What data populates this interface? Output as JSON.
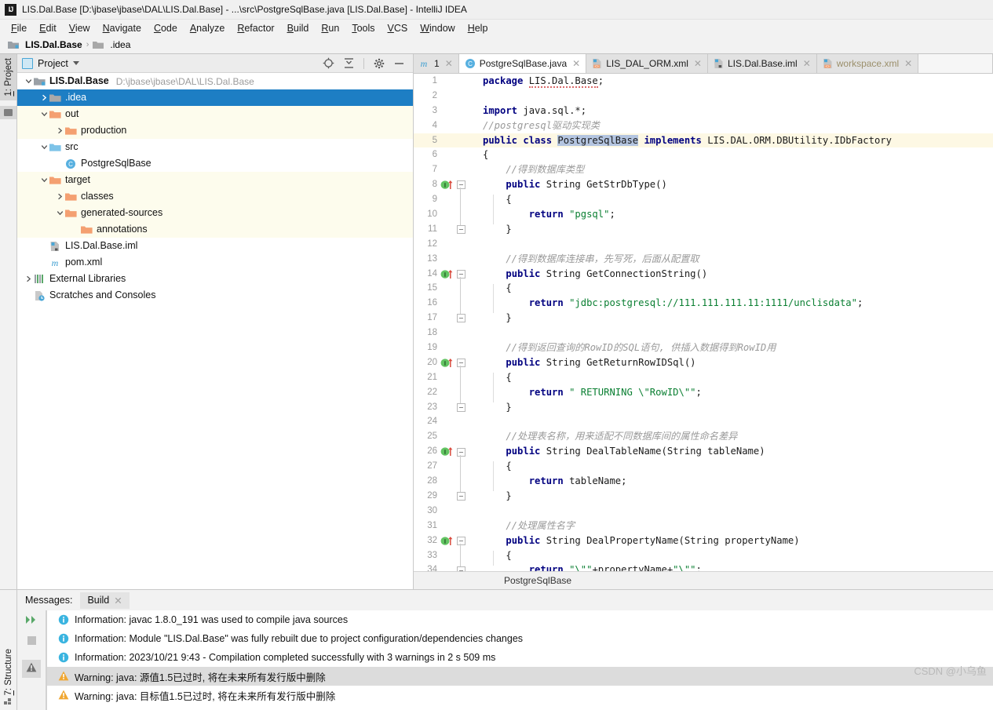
{
  "window": {
    "title": "LIS.Dal.Base [D:\\jbase\\jbase\\DAL\\LIS.Dal.Base] - ...\\src\\PostgreSqlBase.java [LIS.Dal.Base] - IntelliJ IDEA",
    "logo": "IJ"
  },
  "menubar": {
    "items": [
      {
        "label": "File"
      },
      {
        "label": "Edit"
      },
      {
        "label": "View"
      },
      {
        "label": "Navigate"
      },
      {
        "label": "Code"
      },
      {
        "label": "Analyze"
      },
      {
        "label": "Refactor"
      },
      {
        "label": "Build"
      },
      {
        "label": "Run"
      },
      {
        "label": "Tools"
      },
      {
        "label": "VCS"
      },
      {
        "label": "Window"
      },
      {
        "label": "Help"
      }
    ]
  },
  "breadcrumb": {
    "items": [
      {
        "label": "LIS.Dal.Base",
        "icon": "module-icon"
      },
      {
        "label": ".idea",
        "icon": "folder-icon"
      }
    ],
    "separator": "›"
  },
  "left_rail": {
    "project_button": "1: Project",
    "project_button_mnemonic": "1"
  },
  "project_panel": {
    "title": "Project",
    "toolbar": [
      {
        "name": "locate-target-icon"
      },
      {
        "name": "collapse-all-icon"
      },
      {
        "name": "gear-icon"
      },
      {
        "name": "minimize-icon"
      }
    ],
    "tree": [
      {
        "label": "LIS.Dal.Base",
        "path": "D:\\jbase\\jbase\\DAL\\LIS.Dal.Base",
        "depth": 0,
        "arrow": "down",
        "icon": "module-icon",
        "bold": true,
        "state": "normal"
      },
      {
        "label": ".idea",
        "depth": 1,
        "arrow": "right",
        "icon": "folder-gray-icon",
        "state": "selected"
      },
      {
        "label": "out",
        "depth": 1,
        "arrow": "down",
        "icon": "folder-orange-icon",
        "state": "excluded"
      },
      {
        "label": "production",
        "depth": 2,
        "arrow": "right",
        "icon": "folder-orange-icon",
        "state": "excluded"
      },
      {
        "label": "src",
        "depth": 1,
        "arrow": "down",
        "icon": "folder-blue-icon",
        "state": "normal"
      },
      {
        "label": "PostgreSqlBase",
        "depth": 2,
        "arrow": "none",
        "icon": "java-class-icon",
        "state": "normal"
      },
      {
        "label": "target",
        "depth": 1,
        "arrow": "down",
        "icon": "folder-orange-icon",
        "state": "excluded"
      },
      {
        "label": "classes",
        "depth": 2,
        "arrow": "right",
        "icon": "folder-orange-icon",
        "state": "excluded"
      },
      {
        "label": "generated-sources",
        "depth": 2,
        "arrow": "down",
        "icon": "folder-orange-icon",
        "state": "excluded"
      },
      {
        "label": "annotations",
        "depth": 3,
        "arrow": "none",
        "icon": "folder-orange-icon",
        "state": "excluded"
      },
      {
        "label": "LIS.Dal.Base.iml",
        "depth": 1,
        "arrow": "none",
        "icon": "iml-file-icon",
        "state": "normal"
      },
      {
        "label": "pom.xml",
        "depth": 1,
        "arrow": "none",
        "icon": "maven-icon",
        "state": "normal"
      },
      {
        "label": "External Libraries",
        "depth": 0,
        "arrow": "right",
        "icon": "libraries-icon",
        "state": "normal"
      },
      {
        "label": "Scratches and Consoles",
        "depth": 0,
        "arrow": "none",
        "icon": "scratches-icon",
        "state": "normal"
      }
    ]
  },
  "editor": {
    "tabs": [
      {
        "label": "1",
        "icon": "maven-icon",
        "active": false,
        "dim": false,
        "closable": true
      },
      {
        "label": "PostgreSqlBase.java",
        "icon": "java-class-icon",
        "active": true,
        "dim": false,
        "closable": true
      },
      {
        "label": "LIS_DAL_ORM.xml",
        "icon": "xml-file-icon",
        "active": false,
        "dim": false,
        "closable": true
      },
      {
        "label": "LIS.Dal.Base.iml",
        "icon": "iml-file-icon",
        "active": false,
        "dim": false,
        "closable": true
      },
      {
        "label": "workspace.xml",
        "icon": "xml-file-icon",
        "active": false,
        "dim": true,
        "closable": true
      }
    ],
    "status_text": "PostgreSqlBase",
    "highlighted_line": 5,
    "selected_token": "PostgreSqlBase",
    "lines": [
      {
        "n": 1,
        "tokens": [
          {
            "t": "package ",
            "c": "kw"
          },
          {
            "t": "LIS.Dal.Base",
            "c": "plain wavy"
          },
          {
            "t": ";",
            "c": "plain"
          }
        ]
      },
      {
        "n": 2,
        "tokens": []
      },
      {
        "n": 3,
        "tokens": [
          {
            "t": "import ",
            "c": "kw"
          },
          {
            "t": "java.sql.*;",
            "c": "plain"
          }
        ]
      },
      {
        "n": 4,
        "tokens": [
          {
            "t": "//postgresql驱动实现类",
            "c": "cm"
          }
        ]
      },
      {
        "n": 5,
        "tokens": [
          {
            "t": "public class ",
            "c": "kw"
          },
          {
            "t": "PostgreSqlBase",
            "c": "plain sel-tok"
          },
          {
            "t": " ",
            "c": "plain"
          },
          {
            "t": "implements ",
            "c": "kw"
          },
          {
            "t": "LIS.DAL.ORM.DBUtility.IDbFactory",
            "c": "plain"
          }
        ]
      },
      {
        "n": 6,
        "tokens": [
          {
            "t": "{",
            "c": "plain"
          }
        ]
      },
      {
        "n": 7,
        "tokens": [
          {
            "t": "    //得到数据库类型",
            "c": "cm"
          }
        ]
      },
      {
        "n": 8,
        "tokens": [
          {
            "t": "    ",
            "c": "plain"
          },
          {
            "t": "public ",
            "c": "kw"
          },
          {
            "t": "String GetStrDbType()",
            "c": "plain"
          }
        ],
        "gutter": "implements-mark"
      },
      {
        "n": 9,
        "tokens": [
          {
            "t": "    {",
            "c": "plain"
          }
        ]
      },
      {
        "n": 10,
        "tokens": [
          {
            "t": "        ",
            "c": "plain"
          },
          {
            "t": "return ",
            "c": "kw"
          },
          {
            "t": "\"pgsql\"",
            "c": "str"
          },
          {
            "t": ";",
            "c": "plain"
          }
        ]
      },
      {
        "n": 11,
        "tokens": [
          {
            "t": "    }",
            "c": "plain"
          }
        ]
      },
      {
        "n": 12,
        "tokens": []
      },
      {
        "n": 13,
        "tokens": [
          {
            "t": "    //得到数据库连接串，先写死，后面从配置取",
            "c": "cm"
          }
        ]
      },
      {
        "n": 14,
        "tokens": [
          {
            "t": "    ",
            "c": "plain"
          },
          {
            "t": "public ",
            "c": "kw"
          },
          {
            "t": "String GetConnectionString()",
            "c": "plain"
          }
        ],
        "gutter": "implements-mark"
      },
      {
        "n": 15,
        "tokens": [
          {
            "t": "    {",
            "c": "plain"
          }
        ]
      },
      {
        "n": 16,
        "tokens": [
          {
            "t": "        ",
            "c": "plain"
          },
          {
            "t": "return ",
            "c": "kw"
          },
          {
            "t": "\"jdbc:postgresql://111.111.111.11:1111/unclisdata\"",
            "c": "str"
          },
          {
            "t": ";",
            "c": "plain"
          }
        ],
        "redacted": true
      },
      {
        "n": 17,
        "tokens": [
          {
            "t": "    }",
            "c": "plain"
          }
        ]
      },
      {
        "n": 18,
        "tokens": []
      },
      {
        "n": 19,
        "tokens": [
          {
            "t": "    //得到返回查询的RowID的SQL语句, 供插入数据得到RowID用",
            "c": "cm"
          }
        ]
      },
      {
        "n": 20,
        "tokens": [
          {
            "t": "    ",
            "c": "plain"
          },
          {
            "t": "public ",
            "c": "kw"
          },
          {
            "t": "String GetReturnRowIDSql()",
            "c": "plain"
          }
        ],
        "gutter": "implements-mark"
      },
      {
        "n": 21,
        "tokens": [
          {
            "t": "    {",
            "c": "plain"
          }
        ]
      },
      {
        "n": 22,
        "tokens": [
          {
            "t": "        ",
            "c": "plain"
          },
          {
            "t": "return ",
            "c": "kw"
          },
          {
            "t": "\" RETURNING \\\"RowID\\\"\"",
            "c": "str"
          },
          {
            "t": ";",
            "c": "plain"
          }
        ]
      },
      {
        "n": 23,
        "tokens": [
          {
            "t": "    }",
            "c": "plain"
          }
        ]
      },
      {
        "n": 24,
        "tokens": []
      },
      {
        "n": 25,
        "tokens": [
          {
            "t": "    //处理表名称，用来适配不同数据库间的属性命名差异",
            "c": "cm"
          }
        ]
      },
      {
        "n": 26,
        "tokens": [
          {
            "t": "    ",
            "c": "plain"
          },
          {
            "t": "public ",
            "c": "kw"
          },
          {
            "t": "String DealTableName(String tableName)",
            "c": "plain"
          }
        ],
        "gutter": "implements-mark"
      },
      {
        "n": 27,
        "tokens": [
          {
            "t": "    {",
            "c": "plain"
          }
        ]
      },
      {
        "n": 28,
        "tokens": [
          {
            "t": "        ",
            "c": "plain"
          },
          {
            "t": "return ",
            "c": "kw"
          },
          {
            "t": "tableName;",
            "c": "plain"
          }
        ]
      },
      {
        "n": 29,
        "tokens": [
          {
            "t": "    }",
            "c": "plain"
          }
        ]
      },
      {
        "n": 30,
        "tokens": []
      },
      {
        "n": 31,
        "tokens": [
          {
            "t": "    //处理属性名字",
            "c": "cm"
          }
        ]
      },
      {
        "n": 32,
        "tokens": [
          {
            "t": "    ",
            "c": "plain"
          },
          {
            "t": "public ",
            "c": "kw"
          },
          {
            "t": "String DealPropertyName(String propertyName)",
            "c": "plain"
          }
        ],
        "gutter": "implements-mark"
      },
      {
        "n": 33,
        "tokens": [
          {
            "t": "    {",
            "c": "plain"
          }
        ]
      },
      {
        "n": 34,
        "tokens": [
          {
            "t": "        ",
            "c": "plain"
          },
          {
            "t": "return ",
            "c": "kw"
          },
          {
            "t": "\"\\\"\"",
            "c": "str"
          },
          {
            "t": "+propertyName+",
            "c": "plain"
          },
          {
            "t": "\"\\\"\"",
            "c": "str"
          },
          {
            "t": ";",
            "c": "plain"
          }
        ]
      }
    ]
  },
  "bottom_panel": {
    "rail_label": "7: Structure",
    "rail_label_mnemonic": "7",
    "messages_label": "Messages:",
    "tab_label": "Build",
    "toolbar": [
      {
        "name": "expand-all-icon"
      },
      {
        "name": "stop-icon"
      },
      {
        "name": "warning-filter-icon"
      }
    ],
    "rows": [
      {
        "severity": "info",
        "text": "Information: javac 1.8.0_191 was used to compile java sources",
        "selected": false
      },
      {
        "severity": "info",
        "text": "Information: Module \"LIS.Dal.Base\" was fully rebuilt due to project configuration/dependencies changes",
        "selected": false
      },
      {
        "severity": "info",
        "text": "Information: 2023/10/21 9:43 - Compilation completed successfully with 3 warnings in 2 s 509 ms",
        "selected": false
      },
      {
        "severity": "warning",
        "text": "Warning: java: 源值1.5已过时, 将在未来所有发行版中删除",
        "selected": true
      },
      {
        "severity": "warning",
        "text": "Warning: java: 目标值1.5已过时, 将在未来所有发行版中删除",
        "selected": false
      }
    ]
  },
  "watermark": {
    "text": "CSDN @小乌鱼"
  },
  "colors": {
    "selection_blue": "#1d7ec4",
    "excluded_yellow": "#fdfced",
    "highlight_line": "#fdf8e4",
    "keyword": "#000080",
    "string": "#0a7f32",
    "comment": "#9a9a9a",
    "redaction_red": "#e8322a"
  }
}
